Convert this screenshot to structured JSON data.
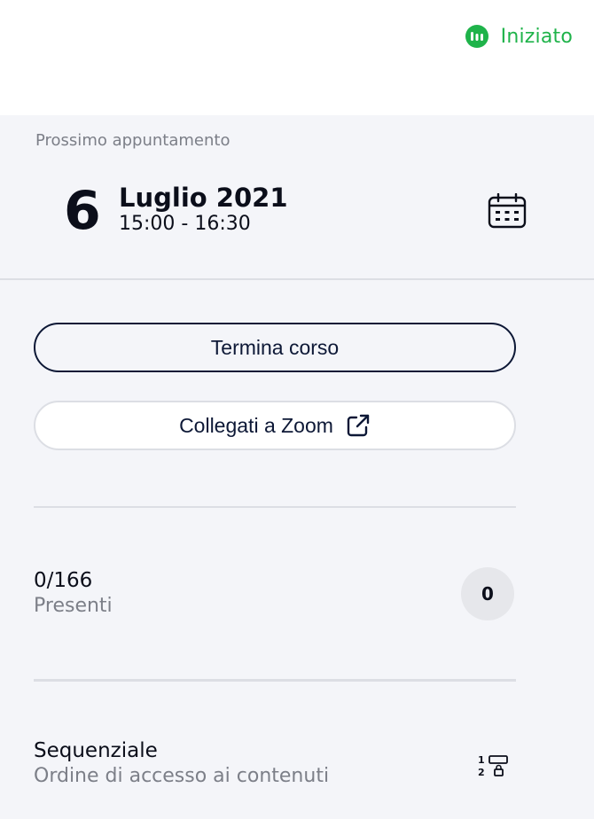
{
  "header": {
    "status_label": "Iniziato",
    "status_color": "#1fb34a",
    "status_icon": "bar-chart-icon"
  },
  "appointment": {
    "label": "Prossimo appuntamento",
    "day": "6",
    "month_year": "Luglio 2021",
    "time": "15:00 - 16:30",
    "icon": "calendar-icon"
  },
  "actions": {
    "end_course_label": "Termina corso",
    "zoom_label": "Collegati a Zoom",
    "zoom_icon": "external-link-icon"
  },
  "attendance": {
    "count": "0/166",
    "label": "Presenti",
    "badge": "0"
  },
  "sequence": {
    "title": "Sequenziale",
    "subtitle": "Ordine di accesso ai contenuti",
    "icon": "sequential-lock-icon"
  },
  "colors": {
    "accent_green": "#1fb34a",
    "navy": "#0d1836",
    "muted_text": "#7c7f88"
  }
}
